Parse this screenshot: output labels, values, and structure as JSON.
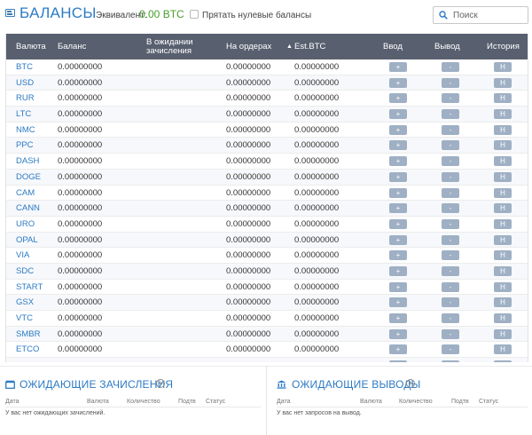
{
  "header": {
    "title": "БАЛАНСЫ",
    "equiv_label": "Эквивалент:",
    "equiv_value": "0.00 BTC",
    "hide_zero_label": "Прятать нулевые балансы",
    "search_placeholder": "Поиск"
  },
  "table": {
    "columns": {
      "currency": "Валюта",
      "balance": "Баланс",
      "pending_line1": "В ожидании",
      "pending_line2": "зачисления",
      "on_orders": "На ордерах",
      "est_btc": "Est.BTC",
      "deposit": "Ввод",
      "withdraw": "Вывод",
      "history": "История"
    },
    "button_labels": {
      "deposit": "+",
      "withdraw": "-",
      "history": "H"
    },
    "rows": [
      {
        "currency": "BTC",
        "balance": "0.00000000",
        "on_orders": "0.00000000",
        "est_btc": "0.00000000"
      },
      {
        "currency": "USD",
        "balance": "0.00000000",
        "on_orders": "0.00000000",
        "est_btc": "0.00000000"
      },
      {
        "currency": "RUR",
        "balance": "0.00000000",
        "on_orders": "0.00000000",
        "est_btc": "0.00000000"
      },
      {
        "currency": "LTC",
        "balance": "0.00000000",
        "on_orders": "0.00000000",
        "est_btc": "0.00000000"
      },
      {
        "currency": "NMC",
        "balance": "0.00000000",
        "on_orders": "0.00000000",
        "est_btc": "0.00000000"
      },
      {
        "currency": "PPC",
        "balance": "0.00000000",
        "on_orders": "0.00000000",
        "est_btc": "0.00000000"
      },
      {
        "currency": "DASH",
        "balance": "0.00000000",
        "on_orders": "0.00000000",
        "est_btc": "0.00000000"
      },
      {
        "currency": "DOGE",
        "balance": "0.00000000",
        "on_orders": "0.00000000",
        "est_btc": "0.00000000"
      },
      {
        "currency": "CAM",
        "balance": "0.00000000",
        "on_orders": "0.00000000",
        "est_btc": "0.00000000"
      },
      {
        "currency": "CANN",
        "balance": "0.00000000",
        "on_orders": "0.00000000",
        "est_btc": "0.00000000"
      },
      {
        "currency": "URO",
        "balance": "0.00000000",
        "on_orders": "0.00000000",
        "est_btc": "0.00000000"
      },
      {
        "currency": "OPAL",
        "balance": "0.00000000",
        "on_orders": "0.00000000",
        "est_btc": "0.00000000"
      },
      {
        "currency": "VIA",
        "balance": "0.00000000",
        "on_orders": "0.00000000",
        "est_btc": "0.00000000"
      },
      {
        "currency": "SDC",
        "balance": "0.00000000",
        "on_orders": "0.00000000",
        "est_btc": "0.00000000"
      },
      {
        "currency": "START",
        "balance": "0.00000000",
        "on_orders": "0.00000000",
        "est_btc": "0.00000000"
      },
      {
        "currency": "GSX",
        "balance": "0.00000000",
        "on_orders": "0.00000000",
        "est_btc": "0.00000000"
      },
      {
        "currency": "VTC",
        "balance": "0.00000000",
        "on_orders": "0.00000000",
        "est_btc": "0.00000000"
      },
      {
        "currency": "SMBR",
        "balance": "0.00000000",
        "on_orders": "0.00000000",
        "est_btc": "0.00000000"
      },
      {
        "currency": "ETCO",
        "balance": "0.00000000",
        "on_orders": "0.00000000",
        "est_btc": "0.00000000"
      },
      {
        "currency": "",
        "balance": "",
        "on_orders": "",
        "est_btc": ""
      }
    ]
  },
  "pending_deposits": {
    "title": "ОЖИДАЮЩИЕ ЗАЧИСЛЕНИЯ",
    "columns": [
      "Дата",
      "Валюта",
      "Количество",
      "Подтв",
      "Статус"
    ],
    "empty_message": "У вас нет ожидающих зачислений."
  },
  "pending_withdrawals": {
    "title": "ОЖИДАЮЩИЕ ВЫВОДЫ",
    "columns": [
      "Дата",
      "Валюта",
      "Количество",
      "Подтв",
      "Статус"
    ],
    "empty_message": "У вас нет запросов на вывод."
  },
  "colors": {
    "accent": "#2d7bc4",
    "equiv_green": "#4a9d2c",
    "table_header": "#58606f",
    "button": "#9fb0c4"
  }
}
